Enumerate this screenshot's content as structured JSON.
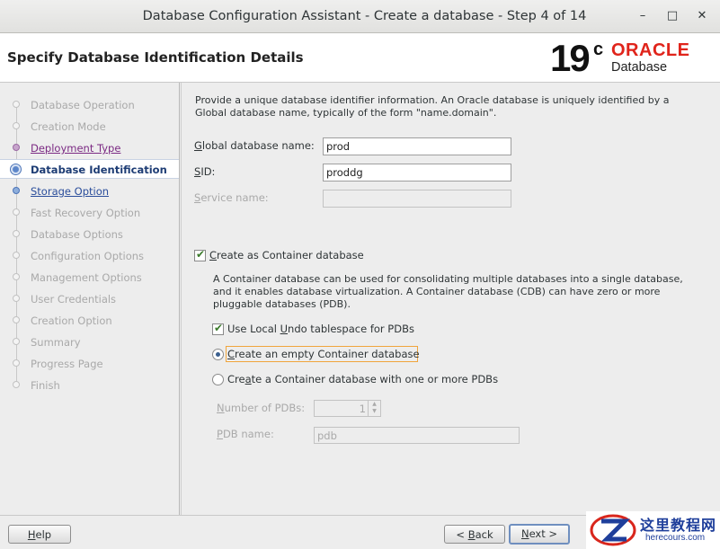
{
  "window": {
    "title": "Database Configuration Assistant - Create a database - Step 4 of 14",
    "minimize_icon": "minimize-icon",
    "maximize_icon": "maximize-icon",
    "close_icon": "close-icon"
  },
  "header": {
    "page_title": "Specify Database Identification Details",
    "logo_version": "19",
    "logo_version_suffix": "c",
    "logo_brand": "ORACLE",
    "logo_product": "Database"
  },
  "sidebar": {
    "items": [
      {
        "label": "Database Operation",
        "state": "disabled"
      },
      {
        "label": "Creation Mode",
        "state": "disabled"
      },
      {
        "label": "Deployment Type",
        "state": "visited"
      },
      {
        "label": "Database Identification",
        "state": "current"
      },
      {
        "label": "Storage Option",
        "state": "link"
      },
      {
        "label": "Fast Recovery Option",
        "state": "disabled"
      },
      {
        "label": "Database Options",
        "state": "disabled"
      },
      {
        "label": "Configuration Options",
        "state": "disabled"
      },
      {
        "label": "Management Options",
        "state": "disabled"
      },
      {
        "label": "User Credentials",
        "state": "disabled"
      },
      {
        "label": "Creation Option",
        "state": "disabled"
      },
      {
        "label": "Summary",
        "state": "disabled"
      },
      {
        "label": "Progress Page",
        "state": "disabled"
      },
      {
        "label": "Finish",
        "state": "disabled"
      }
    ]
  },
  "main": {
    "intro_line1": "Provide a unique database identifier information. An Oracle database is uniquely identified by a",
    "intro_line2": "Global database name, typically of the form \"name.domain\".",
    "global_db_label_underlined": "G",
    "global_db_label_rest": "lobal database name:",
    "global_db_value": "prod",
    "sid_label_underlined": "S",
    "sid_label_rest": "ID:",
    "sid_value": "proddg",
    "service_label_underlined": "S",
    "service_label_rest": "ervice name:",
    "service_value": "",
    "container": {
      "checked": true,
      "label_underlined": "C",
      "label_rest": "reate as Container database",
      "desc_line1": "A Container database can be used for consolidating multiple databases into a single database,",
      "desc_line2": "and it enables database virtualization. A Container database (CDB) can have zero or more",
      "desc_line3": "pluggable databases (PDB).",
      "local_undo_checked": true,
      "local_undo_label_pre": "Use Local ",
      "local_undo_label_underlined": "U",
      "local_undo_label_rest": "ndo tablespace for PDBs",
      "radio_empty_label_underlined": "C",
      "radio_empty_label_rest": "reate an empty Container database",
      "radio_pdbs_label_pre": "Cre",
      "radio_pdbs_label_underlined": "a",
      "radio_pdbs_label_rest": "te a Container database with one or more PDBs",
      "selected_option": "empty",
      "num_pdbs_label_underlined": "N",
      "num_pdbs_label_rest": "umber of PDBs:",
      "num_pdbs_value": "1",
      "pdb_name_label_underlined": "P",
      "pdb_name_label_rest": "DB name:",
      "pdb_name_value": "pdb"
    }
  },
  "footer": {
    "help_label_underlined": "H",
    "help_label_rest": "elp",
    "back_label_pre": "< ",
    "back_label_underlined": "B",
    "back_label_rest": "ack",
    "next_label_underlined": "N",
    "next_label_rest": "ext >"
  },
  "watermark": {
    "chinese_text": "这里教程网",
    "url_text": "herecours.com",
    "logo_icon": "z-logo-icon"
  },
  "colors": {
    "oracle_red": "#e0241b",
    "current_step": "#1d3c74",
    "visited_step": "#7b2a83",
    "link_step": "#2a4d9b",
    "focus_outline": "#f0a53c"
  }
}
